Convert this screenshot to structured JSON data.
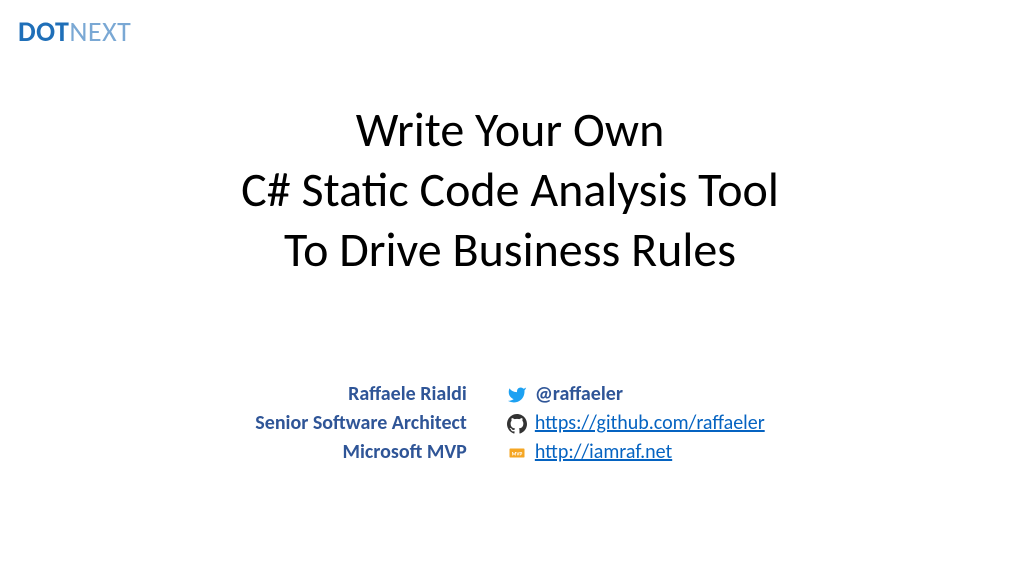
{
  "logo": {
    "part1": "DOT",
    "part2": "NEXT"
  },
  "title": {
    "line1": "Write Your Own",
    "line2": "C# Static Code Analysis Tool",
    "line3": "To Drive Business Rules"
  },
  "credits": {
    "name": "Raffaele Rialdi",
    "role": "Senior Software Architect",
    "award": "Microsoft MVP"
  },
  "social": {
    "twitter_handle": "@raffaeler",
    "github_url": "https://github.com/raffaeler",
    "website_url": "http://iamraf.net"
  }
}
